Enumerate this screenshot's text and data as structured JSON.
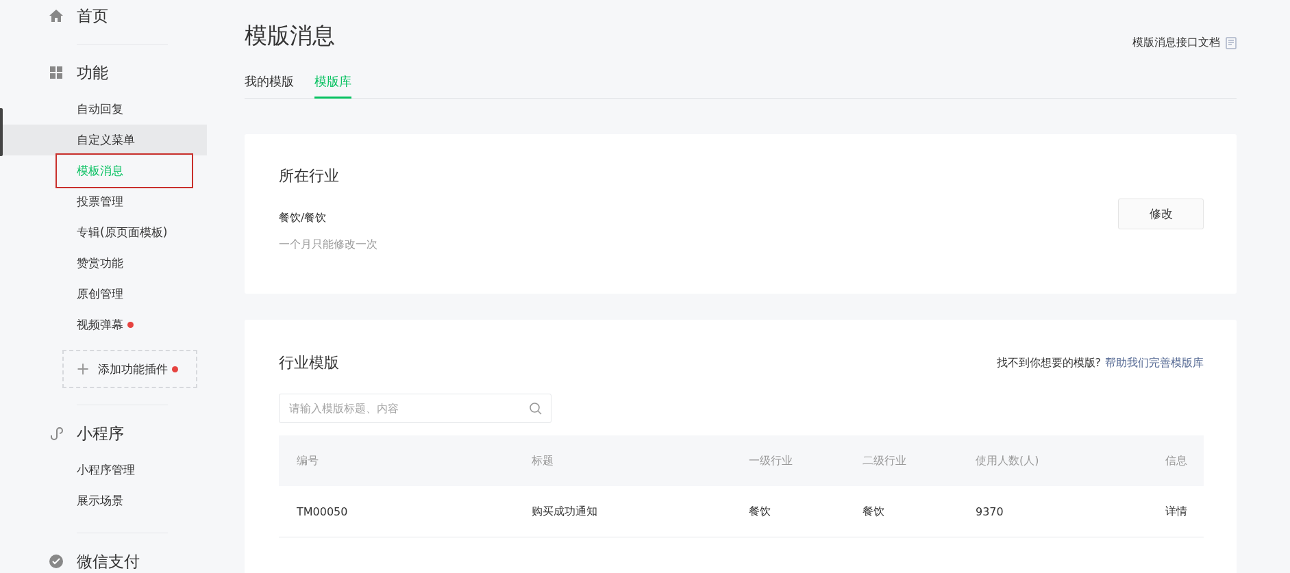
{
  "sidebar": {
    "sections": [
      {
        "title": "首页"
      },
      {
        "title": "功能",
        "items": [
          {
            "label": "自动回复",
            "selected": false,
            "hovered": false,
            "annotated": false,
            "badge": false
          },
          {
            "label": "自定义菜单",
            "selected": false,
            "hovered": true,
            "annotated": false,
            "badge": false
          },
          {
            "label": "模板消息",
            "selected": true,
            "hovered": false,
            "annotated": true,
            "badge": false
          },
          {
            "label": "投票管理",
            "selected": false,
            "hovered": false,
            "annotated": false,
            "badge": false
          },
          {
            "label": "专辑(原页面模板)",
            "selected": false,
            "hovered": false,
            "annotated": false,
            "badge": false
          },
          {
            "label": "赞赏功能",
            "selected": false,
            "hovered": false,
            "annotated": false,
            "badge": false
          },
          {
            "label": "原创管理",
            "selected": false,
            "hovered": false,
            "annotated": false,
            "badge": false
          },
          {
            "label": "视频弹幕",
            "selected": false,
            "hovered": false,
            "annotated": false,
            "badge": true
          }
        ],
        "add_plugin": {
          "icon": "+",
          "label": "添加功能插件",
          "badge": true
        }
      },
      {
        "title": "小程序",
        "items": [
          {
            "label": "小程序管理",
            "selected": false,
            "hovered": false,
            "annotated": false,
            "badge": false
          },
          {
            "label": "展示场景",
            "selected": false,
            "hovered": false,
            "annotated": false,
            "badge": false
          }
        ]
      },
      {
        "title": "微信支付"
      }
    ]
  },
  "page": {
    "title": "模版消息",
    "doc_link": "模版消息接口文档",
    "tabs": [
      {
        "label": "我的模版",
        "selected": false
      },
      {
        "label": "模版库",
        "selected": true
      }
    ]
  },
  "industry_card": {
    "title": "所在行业",
    "value": "餐饮/餐饮",
    "note": "一个月只能修改一次",
    "button": "修改"
  },
  "templates_card": {
    "title": "行业模版",
    "hint": "找不到你想要的模版?",
    "hint_link": "帮助我们完善模版库",
    "search": {
      "placeholder": "请输入模版标题、内容"
    },
    "table": {
      "columns": [
        "编号",
        "标题",
        "一级行业",
        "二级行业",
        "使用人数(人)",
        "信息"
      ],
      "rows": [
        [
          "TM00050",
          "购买成功通知",
          "餐饮",
          "餐饮",
          "9370",
          "详情"
        ]
      ]
    }
  }
}
